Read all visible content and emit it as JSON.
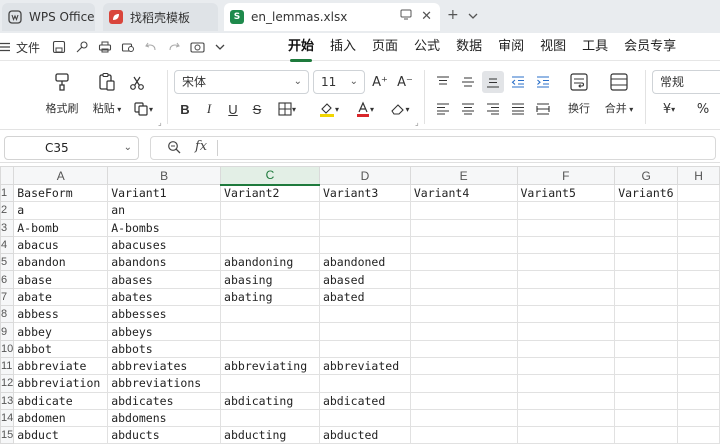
{
  "tabs": [
    {
      "label": "WPS Office",
      "icon": "wps-logo-icon"
    },
    {
      "label": "找稻壳模板",
      "icon": "docer-icon"
    },
    {
      "label": "en_lemmas.xlsx",
      "icon": "spreadsheet-icon",
      "icon_letter": "S"
    }
  ],
  "tab_controls": {
    "new_tab": "+",
    "more": "⌄"
  },
  "menubar": {
    "file_label": "文件",
    "tabs": [
      "开始",
      "插入",
      "页面",
      "公式",
      "数据",
      "审阅",
      "视图",
      "工具",
      "会员专享"
    ],
    "active_tab": "开始"
  },
  "ribbon": {
    "format_painter": "格式刷",
    "paste": "粘贴",
    "font_name": "宋体",
    "font_size": "11",
    "wrap_text": "换行",
    "merge": "合并",
    "number_format": "常规",
    "currency_symbol": "¥",
    "percent_symbol": "%",
    "bold": "B",
    "italic": "I",
    "underline": "U",
    "strike": "S",
    "grow_font": "A⁺",
    "shrink_font": "A⁻"
  },
  "formula_bar": {
    "cell_ref": "C35",
    "fx": "fx",
    "value": ""
  },
  "sheet": {
    "columns": [
      "A",
      "B",
      "C",
      "D",
      "E",
      "F",
      "G",
      "H"
    ],
    "selected_column": "C",
    "row_numbers": [
      "1",
      "2",
      "3",
      "4",
      "5",
      "6",
      "7",
      "8",
      "9",
      "10",
      "11",
      "12",
      "13",
      "14",
      "15"
    ],
    "rows": [
      [
        "BaseForm",
        "Variant1",
        "Variant2",
        "Variant3",
        "Variant4",
        "Variant5",
        "Variant6",
        ""
      ],
      [
        "a",
        "an",
        "",
        "",
        "",
        "",
        "",
        ""
      ],
      [
        "A-bomb",
        "A-bombs",
        "",
        "",
        "",
        "",
        "",
        ""
      ],
      [
        "abacus",
        "abacuses",
        "",
        "",
        "",
        "",
        "",
        ""
      ],
      [
        "abandon",
        "abandons",
        "abandoning",
        "abandoned",
        "",
        "",
        "",
        ""
      ],
      [
        "abase",
        "abases",
        "abasing",
        "abased",
        "",
        "",
        "",
        ""
      ],
      [
        "abate",
        "abates",
        "abating",
        "abated",
        "",
        "",
        "",
        ""
      ],
      [
        "abbess",
        "abbesses",
        "",
        "",
        "",
        "",
        "",
        ""
      ],
      [
        "abbey",
        "abbeys",
        "",
        "",
        "",
        "",
        "",
        ""
      ],
      [
        "abbot",
        "abbots",
        "",
        "",
        "",
        "",
        "",
        ""
      ],
      [
        "abbreviate",
        "abbreviates",
        "abbreviating",
        "abbreviated",
        "",
        "",
        "",
        ""
      ],
      [
        "abbreviation",
        "abbreviations",
        "",
        "",
        "",
        "",
        "",
        ""
      ],
      [
        "abdicate",
        "abdicates",
        "abdicating",
        "abdicated",
        "",
        "",
        "",
        ""
      ],
      [
        "abdomen",
        "abdomens",
        "",
        "",
        "",
        "",
        "",
        ""
      ],
      [
        "abduct",
        "abducts",
        "abducting",
        "abducted",
        "",
        "",
        "",
        ""
      ]
    ]
  },
  "colors": {
    "accent": "#1e7a3c",
    "sheet_icon": "#1f8a4c",
    "docer_icon": "#d9453b"
  }
}
